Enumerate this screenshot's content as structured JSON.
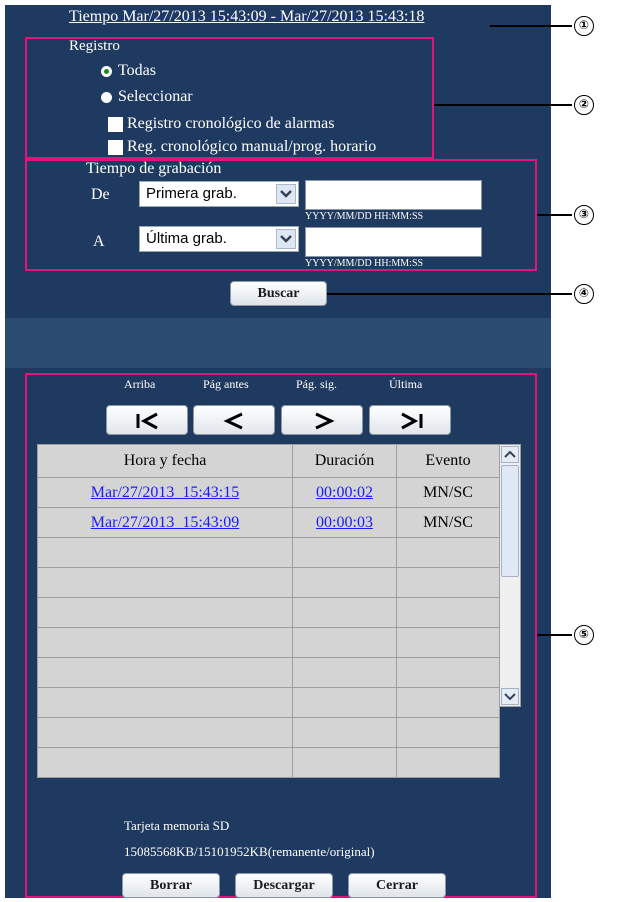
{
  "time_range": "Tiempo Mar/27/2013 15:43:09 - Mar/27/2013 15:43:18",
  "registro": {
    "label": "Registro",
    "options": [
      "Todas",
      "Seleccionar"
    ],
    "selected": "Todas",
    "checkboxes": [
      "Registro cronológico de alarmas",
      "Reg. cronológico manual/prog. horario"
    ]
  },
  "tiempo": {
    "label": "Tiempo de grabación",
    "from_label": "De",
    "from_value": "Primera grab.",
    "to_label": "A",
    "to_value": "Última grab.",
    "format": "YYYY/MM/DD HH:MM:SS"
  },
  "search_button": "Buscar",
  "nav": {
    "top": "Arriba",
    "prev": "Pág antes",
    "next": "Pág. sig.",
    "last": "Última"
  },
  "table": {
    "headers": [
      "Hora y fecha",
      "Duración",
      "Evento"
    ],
    "rows": [
      {
        "datetime": "Mar/27/2013  15:43:15",
        "duration": "00:00:02",
        "event": "MN/SC"
      },
      {
        "datetime": "Mar/27/2013  15:43:09",
        "duration": "00:00:03",
        "event": "MN/SC"
      }
    ]
  },
  "sd": {
    "label": "Tarjeta memoria SD",
    "usage": "15085568KB/15101952KB(remanente/original)"
  },
  "buttons": {
    "delete": "Borrar",
    "download": "Descargar",
    "close": "Cerrar"
  },
  "callouts": [
    "①",
    "②",
    "③",
    "④",
    "⑤"
  ],
  "colors": {
    "panel": "#1f3a60",
    "outline": "#e0147a",
    "link": "#1a1aff"
  }
}
